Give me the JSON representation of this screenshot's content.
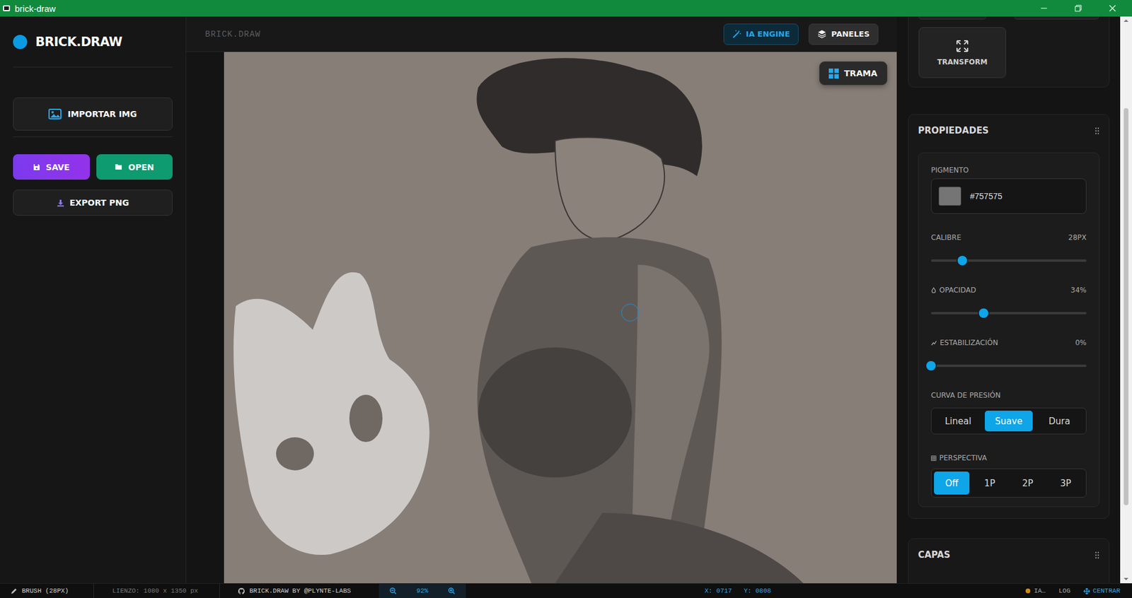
{
  "window": {
    "title": "brick-draw"
  },
  "sidebar": {
    "logo": "BRICK.DRAW",
    "import_button": "IMPORTAR IMG",
    "save_button": "SAVE",
    "open_button": "OPEN",
    "export_button": "EXPORT PNG"
  },
  "header": {
    "title": "BRICK.DRAW",
    "buttons": [
      {
        "label": "IA ENGINE",
        "selected": true
      },
      {
        "label": "PANELES",
        "selected": false
      }
    ]
  },
  "canvas": {
    "overlay_button": "TRAMA"
  },
  "tools": [
    {
      "label": "TRANSFORM"
    }
  ],
  "properties": {
    "title": "PROPIEDADES",
    "pigment": {
      "label": "PIGMENTO",
      "value": "#757575"
    },
    "sliders": [
      {
        "label": "CALIBRE",
        "reading": "28PX",
        "level": 0.2
      },
      {
        "label": "OPACIDAD",
        "reading": "34%",
        "level": 0.34
      },
      {
        "label": "ESTABILIZACIÓN",
        "reading": "0%",
        "level": 0
      }
    ],
    "pressure_curve": {
      "label": "CURVA DE PRESIÓN",
      "options": [
        {
          "label": "Lineal",
          "selected": false
        },
        {
          "label": "Suave",
          "selected": true
        },
        {
          "label": "Dura",
          "selected": false
        }
      ]
    },
    "perspective": {
      "label": "PERSPECTIVA",
      "options": [
        {
          "label": "Off",
          "selected": true
        },
        {
          "label": "1P",
          "selected": false
        },
        {
          "label": "2P",
          "selected": false
        },
        {
          "label": "3P",
          "selected": false
        }
      ]
    }
  },
  "layers": {
    "title": "CAPAS"
  },
  "status_bar": {
    "tool": "BRUSH (28PX)",
    "canvas_size": "LIENZO: 1080 x 1350 px",
    "credit": "BRICK.DRAW BY @PLYNTE-LABS",
    "zoom": "92%",
    "x": "X: 0717",
    "y": "Y: 0808",
    "ia": "IA…",
    "log": "LOG",
    "center": "CENTRAR"
  }
}
